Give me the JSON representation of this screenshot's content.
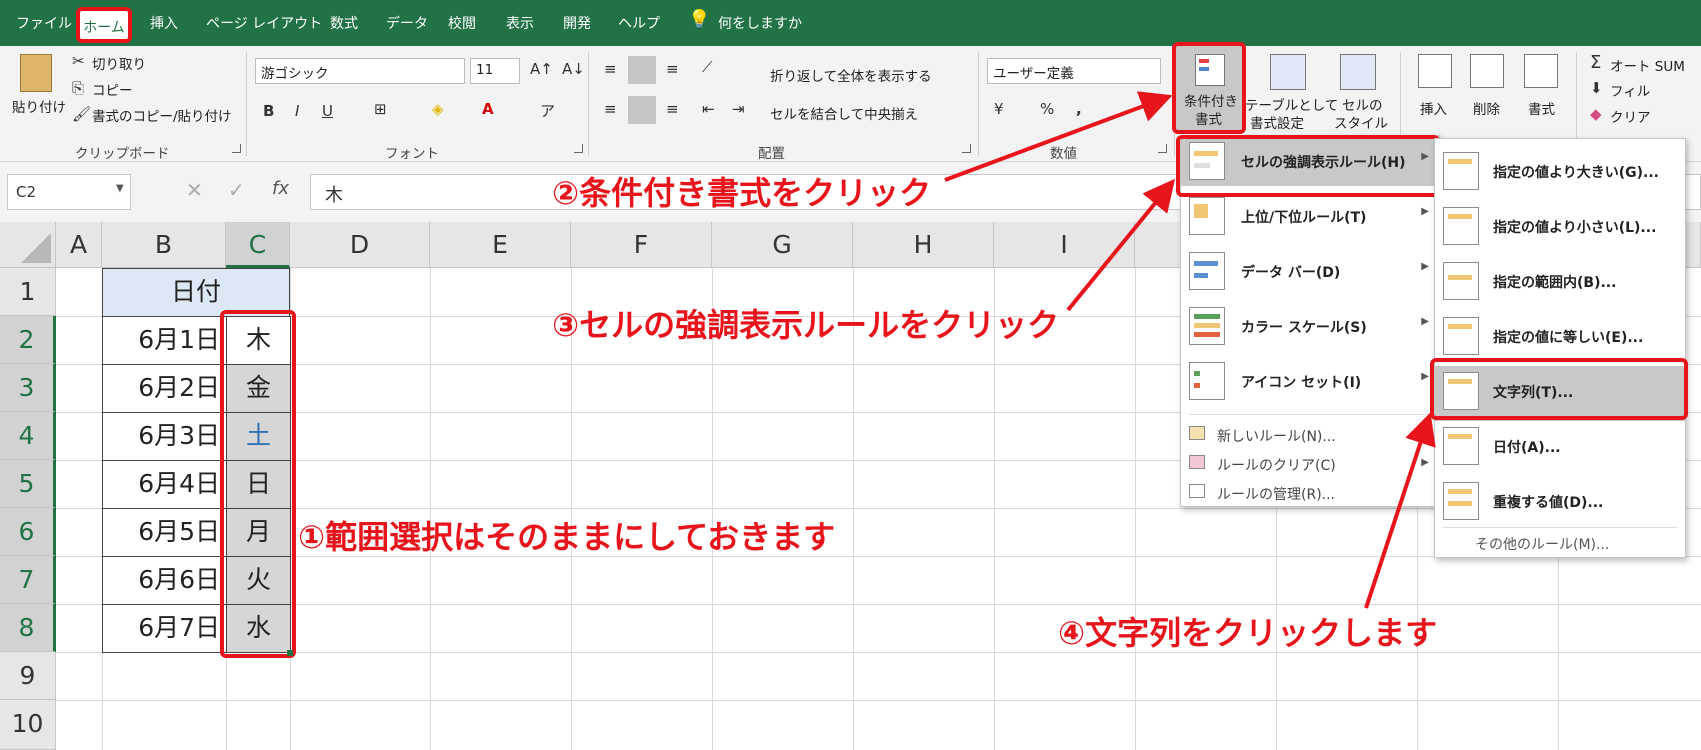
{
  "menu_bar": {
    "tabs": [
      "ファイル",
      "ホーム",
      "挿入",
      "ページ レイアウト",
      "数式",
      "データ",
      "校閲",
      "表示",
      "開発",
      "ヘルプ"
    ],
    "tell_me": "何をしますか"
  },
  "ribbon": {
    "clipboard": {
      "paste": "貼り付け",
      "cut": "切り取り",
      "copy": "コピー",
      "format_painter": "書式のコピー/貼り付け",
      "label": "クリップボード"
    },
    "font": {
      "name": "游ゴシック",
      "size": "11",
      "label": "フォント",
      "bold": "B",
      "italic": "I",
      "underline": "U"
    },
    "alignment": {
      "wrap": "折り返して全体を表示する",
      "merge": "セルを結合して中央揃え",
      "label": "配置"
    },
    "number": {
      "format": "ユーザー定義",
      "percent": "%",
      "comma": ",",
      "label": "数値"
    },
    "styles": {
      "conditional": "条件付き書式",
      "conditional_line1": "条件付き",
      "conditional_line2": "書式",
      "table_line1": "テーブルとして",
      "table_line2": "書式設定",
      "cell_line1": "セルの",
      "cell_line2": "スタイル"
    },
    "cells": {
      "insert": "挿入",
      "delete": "削除",
      "format": "書式"
    },
    "editing": {
      "autosum": "オート SUM",
      "fill": "フィル",
      "clear": "クリア"
    }
  },
  "formula_bar": {
    "name_box": "C2",
    "fx": "fx",
    "content": "木"
  },
  "sheet": {
    "columns": [
      "A",
      "B",
      "C",
      "D",
      "E",
      "F",
      "G",
      "H",
      "I"
    ],
    "rows": [
      "1",
      "2",
      "3",
      "4",
      "5",
      "6",
      "7",
      "8",
      "9",
      "10"
    ],
    "header_b1": "日付",
    "dates": [
      "6月1日",
      "6月2日",
      "6月3日",
      "6月4日",
      "6月5日",
      "6月6日",
      "6月7日"
    ],
    "weekdays": [
      "木",
      "金",
      "土",
      "日",
      "月",
      "火",
      "水"
    ]
  },
  "cf_menu": {
    "items": [
      {
        "label": "セルの強調表示ルール(H)"
      },
      {
        "label": "上位/下位ルール(T)"
      },
      {
        "label": "データ バー(D)"
      },
      {
        "label": "カラー スケール(S)"
      },
      {
        "label": "アイコン セット(I)"
      }
    ],
    "small_items": [
      "新しいルール(N)...",
      "ルールのクリア(C)",
      "ルールの管理(R)..."
    ]
  },
  "highlight_submenu": {
    "items": [
      "指定の値より大きい(G)...",
      "指定の値より小さい(L)...",
      "指定の範囲内(B)...",
      "指定の値に等しい(E)...",
      "文字列(T)...",
      "日付(A)...",
      "重複する値(D)..."
    ],
    "more": "その他のルール(M)..."
  },
  "annotations": {
    "step1": "①範囲選択はそのままにしておきます",
    "step2": "②条件付き書式をクリック",
    "step3": "③セルの強調表示ルールをクリック",
    "step4": "④文字列をクリックします"
  },
  "colors": {
    "excel_green": "#217346",
    "annotation_red": "#e8141b",
    "saturday_blue": "#2e74b5",
    "header_fill": "#dce9f5",
    "selection_fill": "#d6d6d6"
  }
}
